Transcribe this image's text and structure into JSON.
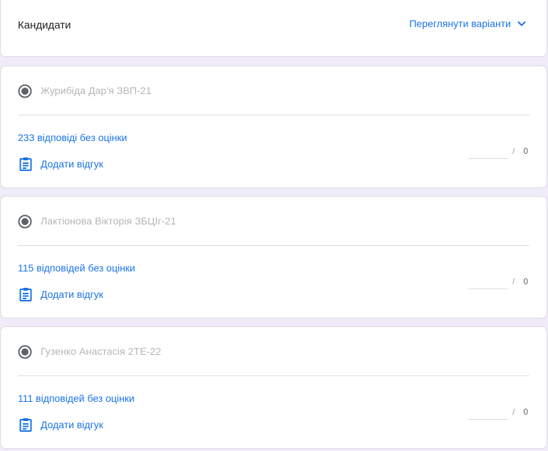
{
  "header": {
    "title": "Кандидати",
    "view_variants_label": "Переглянути варіанти",
    "view_variants_icon": "chevron-down-icon"
  },
  "colors": {
    "accent": "#1a73e8",
    "background": "#f0ebf8",
    "muted_text": "#b5b5b5"
  },
  "candidates": [
    {
      "name": "Журибіда Дар'я ЗВП-21",
      "ungraded": "233 відповіді без оцінки",
      "feedback_label": "Додати відгук",
      "score_value": "",
      "slash": "/",
      "max_score": "0"
    },
    {
      "name": "Лактіонова Вікторія ЗБЦІг-21",
      "ungraded": "115 відповідей без оцінки",
      "feedback_label": "Додати відгук",
      "score_value": "",
      "slash": "/",
      "max_score": "0"
    },
    {
      "name": "Гузенко Анастасія 2ТЕ-22",
      "ungraded": "111 відповідей без оцінки",
      "feedback_label": "Додати відгук",
      "score_value": "",
      "slash": "/",
      "max_score": "0"
    }
  ]
}
